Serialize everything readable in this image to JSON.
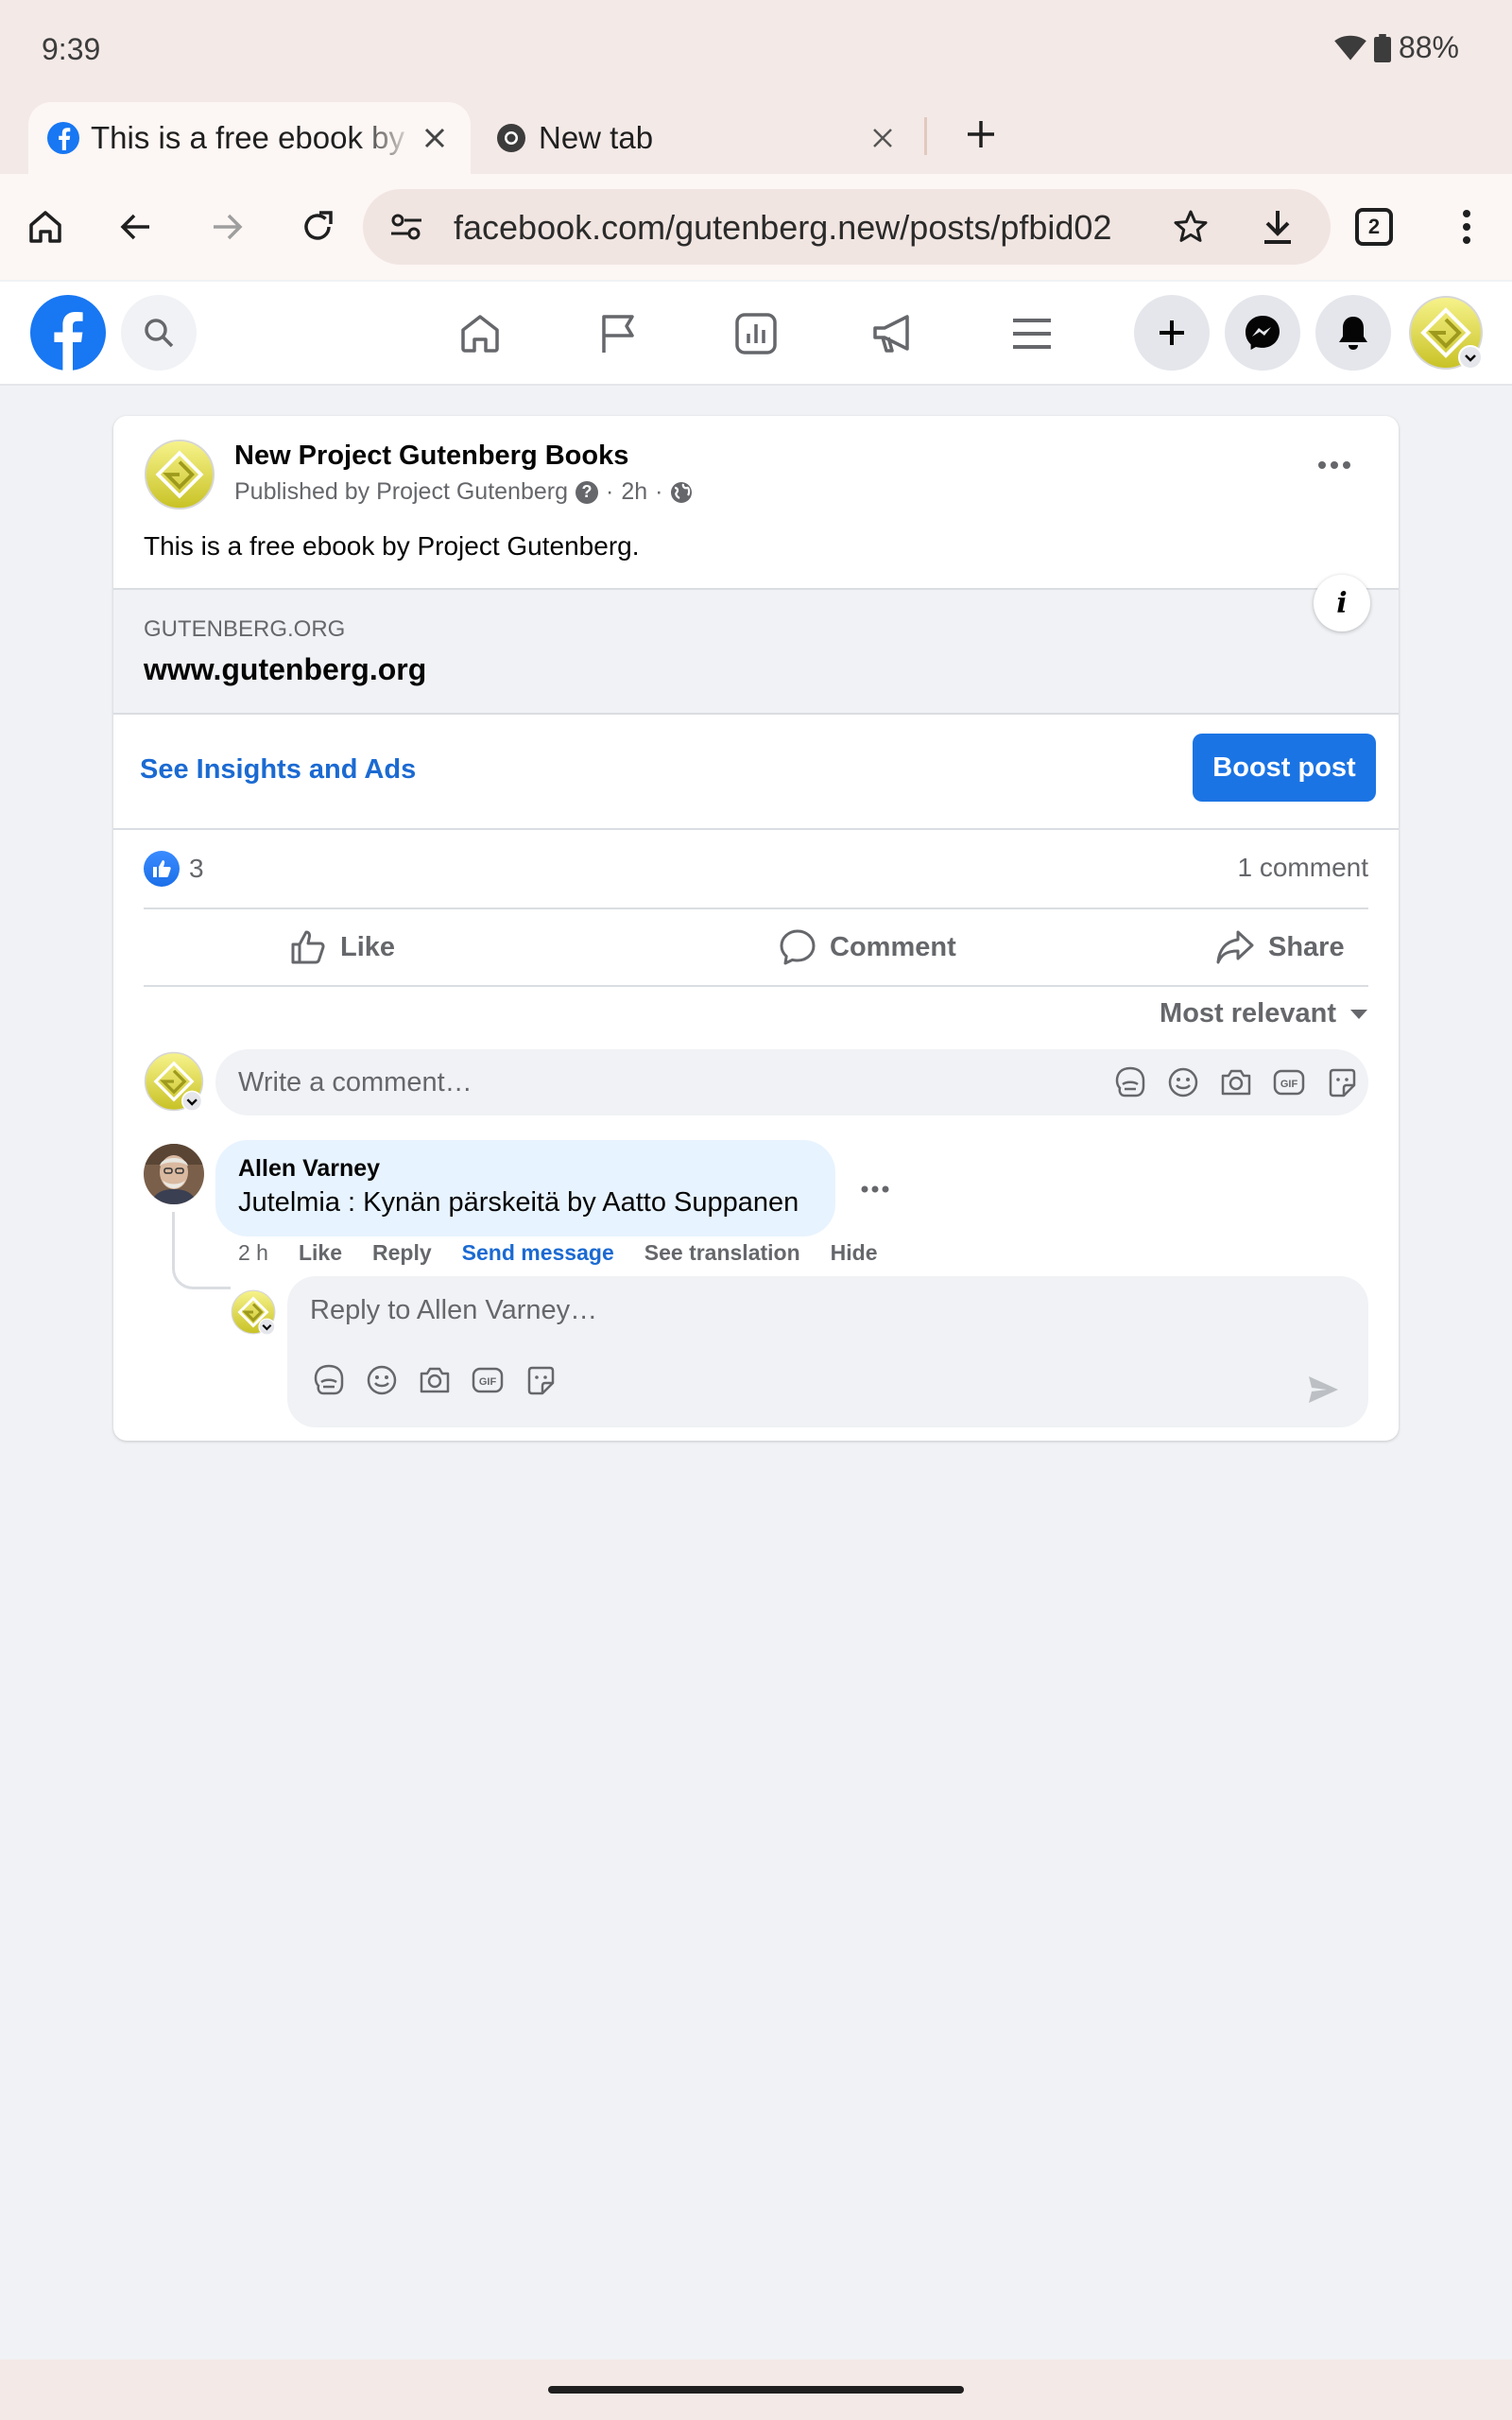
{
  "status_bar": {
    "time": "9:39",
    "battery": "88%"
  },
  "tabs": [
    {
      "title": "This is a free ebook by Project Gutenberg",
      "active": true
    },
    {
      "title": "New tab",
      "active": false
    }
  ],
  "toolbar": {
    "url": "facebook.com/gutenberg.new/posts/pfbid02",
    "tab_count": "2"
  },
  "post": {
    "page_name": "New Project Gutenberg Books",
    "published_by": "Published by Project Gutenberg",
    "time": "2h",
    "text": "This is a free ebook by Project Gutenberg.",
    "link_domain": "GUTENBERG.ORG",
    "link_title": "www.gutenberg.org",
    "insights_label": "See Insights and Ads",
    "boost_label": "Boost post",
    "reaction_count": "3",
    "comment_count": "1 comment",
    "actions": {
      "like": "Like",
      "comment": "Comment",
      "share": "Share"
    },
    "sort_label": "Most relevant",
    "write_placeholder": "Write a comment…"
  },
  "comment": {
    "author": "Allen Varney",
    "text": "Jutelmia : Kynän pärskeitä by Aatto Suppanen",
    "time": "2 h",
    "actions": {
      "like": "Like",
      "reply": "Reply",
      "send_message": "Send message",
      "see_translation": "See translation",
      "hide": "Hide"
    },
    "reply_placeholder": "Reply to Allen Varney…"
  },
  "colors": {
    "facebook_blue": "#1877f2",
    "link_blue": "#1b6ad2",
    "boost_blue": "#1b74e4",
    "chrome_bg": "#f3e9e7"
  }
}
